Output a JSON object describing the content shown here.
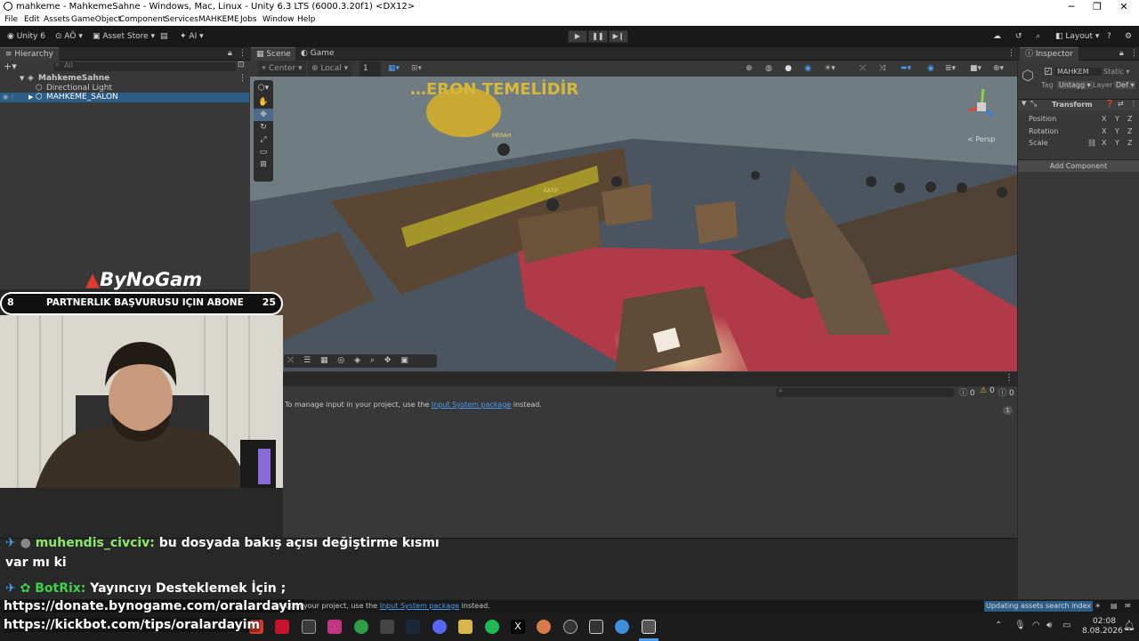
{
  "window": {
    "title": "mahkeme - MahkemeSahne - Windows, Mac, Linux - Unity 6.3 LTS (6000.3.20f1) <DX12>",
    "minimize": "─",
    "maximize": "❐",
    "close": "✕"
  },
  "menu": [
    "File",
    "Edit",
    "Assets",
    "GameObject",
    "Component",
    "Services",
    "MAHKEME",
    "Jobs",
    "Window",
    "Help"
  ],
  "toolbar": {
    "unity": "Unity 6",
    "account": "AÖ",
    "asset_store": "Asset Store",
    "ai": "AI",
    "layout": "Layout"
  },
  "hierarchy": {
    "tab": "Hierarchy",
    "search_placeholder": "All",
    "scene": "MahkemeSahne",
    "items": [
      "Directional Light",
      "MAHKEME_SALON"
    ]
  },
  "scene": {
    "tabs": [
      "Scene",
      "Game"
    ],
    "pivot": "Center",
    "space": "Local",
    "grid_value": "1",
    "wall_text": "…ERON TEMELİDİR",
    "persp": "< Persp",
    "labels": [
      "MERAH",
      "KATIP"
    ]
  },
  "inspector": {
    "tab": "Inspector",
    "object_name": "MAHKEM",
    "static": "Static",
    "tag_label": "Tag",
    "tag_value": "Untagg",
    "layer_label": "Layer",
    "layer_value": "Def",
    "component": "Transform",
    "rows": [
      "Position",
      "Rotation",
      "Scale"
    ],
    "axes": [
      "X",
      "Y",
      "Z"
    ],
    "add_component": "Add Component"
  },
  "console": {
    "message_prefix": "To manage input in your project, use the",
    "link": "Input System package",
    "message_suffix": "instead.",
    "count_info": "0",
    "count_warn": "0",
    "count_err": "0",
    "collapse_count": "1"
  },
  "statusbar": {
    "message_prefix": "input in your project, use the",
    "link": "Input System package",
    "message_suffix": "instead.",
    "progress_text": "Updating assets search index"
  },
  "overlay": {
    "brand": "ByNoGam",
    "left_count": "8",
    "banner": "PARTNERLIK BAŞVURUSU IÇIN ABONE",
    "right_count": "25"
  },
  "chat": [
    {
      "user": "muhendis_civciv:",
      "message": "bu dosyada bakış açısı değiştirme kısmı",
      "continuation": "var mı ki"
    },
    {
      "user": "BotRix:",
      "message": "Yayıncıyı Desteklemek İçin ;"
    }
  ],
  "links": {
    "donate": "https://donate.bynogame.com/oralardayim",
    "kickbot": "https://kickbot.com/tips/oralardayim"
  },
  "taskbar": {
    "time": "02:08",
    "date": "8.08.2026"
  },
  "colors": {
    "selection": "#2c5d87",
    "link": "#4c9bf0",
    "accent_chat_user": "#8de86a",
    "carpet": "#b03a48"
  }
}
